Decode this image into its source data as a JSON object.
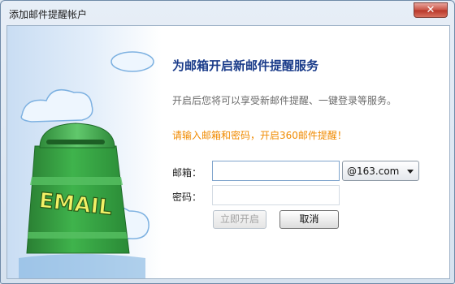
{
  "window": {
    "title": "添加邮件提醒帐户",
    "close_symbol": "✕"
  },
  "illustration": {
    "mailbox_text": "EMAIL"
  },
  "main": {
    "heading": "为邮箱开启新邮件提醒服务",
    "subtitle": "开启后您将可以享受新邮件提醒、一键登录等服务。",
    "prompt": "请输入邮箱和密码，开启360邮件提醒！"
  },
  "form": {
    "email_label": "邮箱：",
    "email_value": "",
    "password_label": "密码：",
    "password_value": "",
    "domain_selected": "@163.com"
  },
  "buttons": {
    "open_label": "立即开启",
    "cancel_label": "取消"
  },
  "colors": {
    "heading": "#1b3c8a",
    "prompt": "#f08a00",
    "mailbox_green": "#2f9a3c",
    "close_button": "#c85244"
  }
}
